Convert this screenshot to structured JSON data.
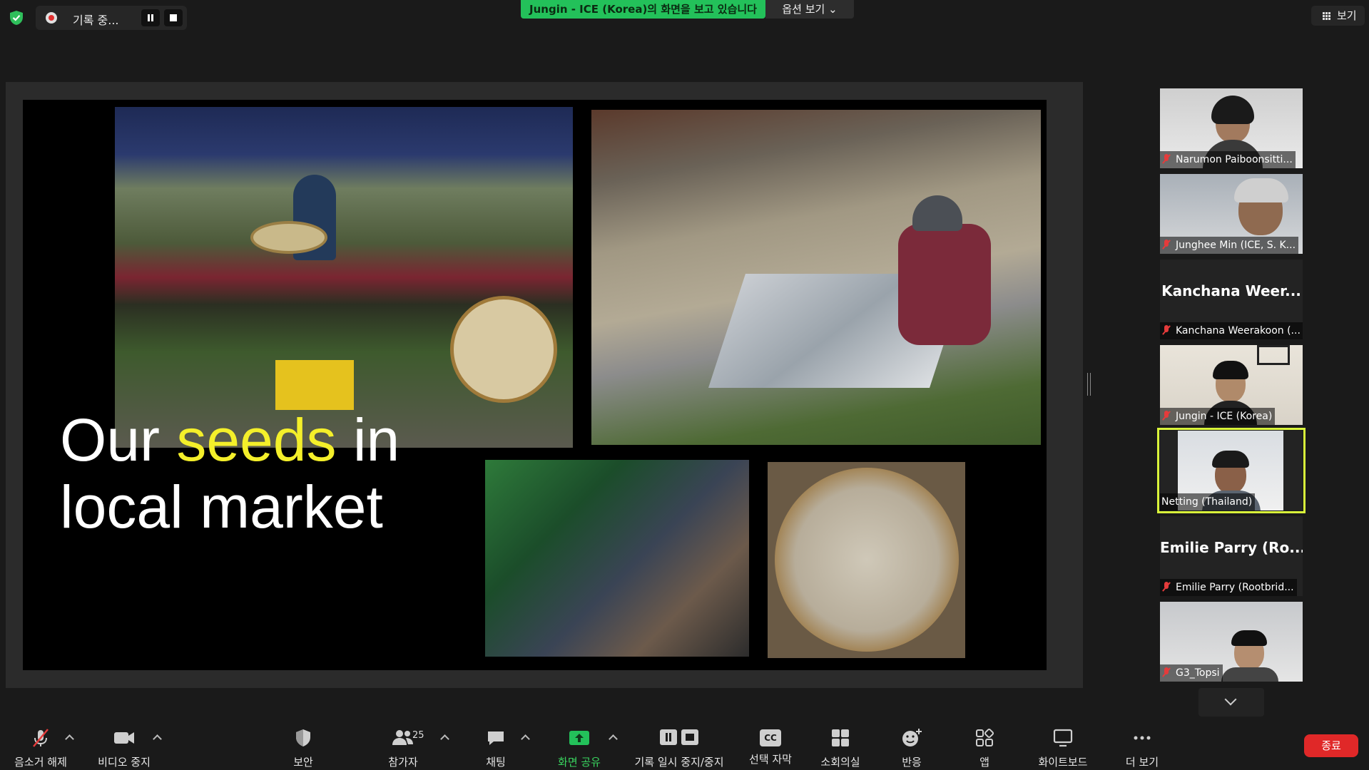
{
  "top": {
    "recording_label": "기록 중...",
    "share_banner": "Jungin - ICE (Korea)의 화면을 보고 있습니다",
    "view_options": "옵션 보기 ⌄",
    "view_button": "보기"
  },
  "slide": {
    "title_line1_a": "Our ",
    "title_line1_hl": "seeds",
    "title_line1_b": " in",
    "title_line2": "local market",
    "highlight_color": "#f4ef2a"
  },
  "participants": [
    {
      "name": "Narumon Paiboonsitti...",
      "muted": true,
      "video": true
    },
    {
      "name": "Junghee Min (ICE, S. K...",
      "muted": true,
      "video": true
    },
    {
      "display_name": "Kanchana  Weer...",
      "name": "Kanchana Weerakoon (...",
      "muted": true,
      "video": false
    },
    {
      "name": "Jungin - ICE (Korea)",
      "muted": true,
      "video": true
    },
    {
      "name": "Netting (Thailand)",
      "muted": false,
      "video": true,
      "active_speaker": true
    },
    {
      "display_name": "Emilie Parry  (Ro...",
      "name": "Emilie Parry (Rootbrid...",
      "muted": true,
      "video": false
    },
    {
      "name": "G3_Topsi",
      "muted": true,
      "video": true
    }
  ],
  "toolbar": {
    "unmute": "음소거 해제",
    "stop_video": "비디오 중지",
    "security": "보안",
    "participants": "참가자",
    "participants_count": "25",
    "chat": "채팅",
    "share_screen": "화면 공유",
    "pause_stop_recording": "기록 일시 중지/중지",
    "captions": "선택 자막",
    "captions_icon_text": "CC",
    "breakout": "소회의실",
    "reactions": "반응",
    "apps": "앱",
    "whiteboard": "화이트보드",
    "more": "더 보기",
    "end": "종료"
  },
  "colors": {
    "share_green": "#23c15a",
    "end_red": "#e02828",
    "active_speaker": "#d9f53a",
    "muted_red": "#e53b3b"
  }
}
